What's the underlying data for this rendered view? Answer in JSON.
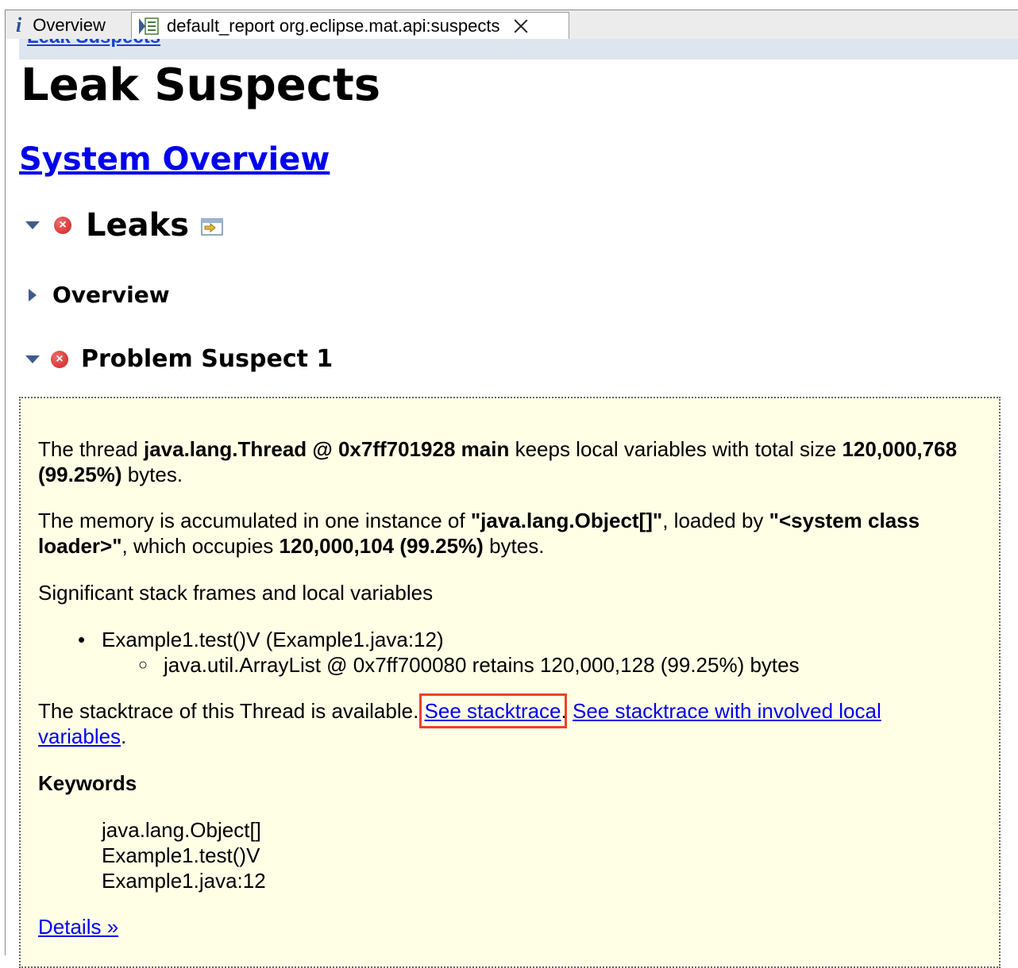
{
  "tabs": [
    {
      "label": "Overview",
      "icon": "info-icon"
    },
    {
      "label": "default_report org.eclipse.mat.api:suspects",
      "icon": "report-icon"
    }
  ],
  "breadcrumb": "Leak Suspects",
  "page_title": "Leak Suspects",
  "system_overview_link": "System Overview",
  "leaks_heading": "Leaks",
  "overview_heading": "Overview",
  "suspect_heading": "Problem Suspect 1",
  "suspect": {
    "p1": {
      "a": "The thread ",
      "thread": "java.lang.Thread @ 0x7ff701928 main",
      "b": " keeps local variables with total size ",
      "size": "120,000,768 (99.25%)",
      "c": " bytes."
    },
    "p2": {
      "a": "The memory is accumulated in one instance of ",
      "type": "\"java.lang.Object[]\"",
      "b": ", loaded by ",
      "loader": "\"<system class loader>\"",
      "c": ", which occupies ",
      "size": "120,000,104 (99.25%)",
      "d": " bytes."
    },
    "p3": "Significant stack frames and local variables",
    "frame": "Example1.test()V (Example1.java:12)",
    "local_var": "java.util.ArrayList @ 0x7ff700080 retains 120,000,128 (99.25%) bytes",
    "p4": {
      "a": "The stacktrace of this Thread is available. ",
      "link1": "See stacktrace",
      "sep": ". ",
      "link2": "See stacktrace with involved local variables",
      "end": "."
    },
    "keywords_label": "Keywords",
    "keywords": [
      "java.lang.Object[]",
      "Example1.test()V",
      "Example1.java:12"
    ],
    "details_link": "Details »"
  },
  "colors": {
    "link": "#0000ee",
    "box_bg": "#ffffe6",
    "highlight": "#e8432a",
    "error": "#c92222"
  }
}
